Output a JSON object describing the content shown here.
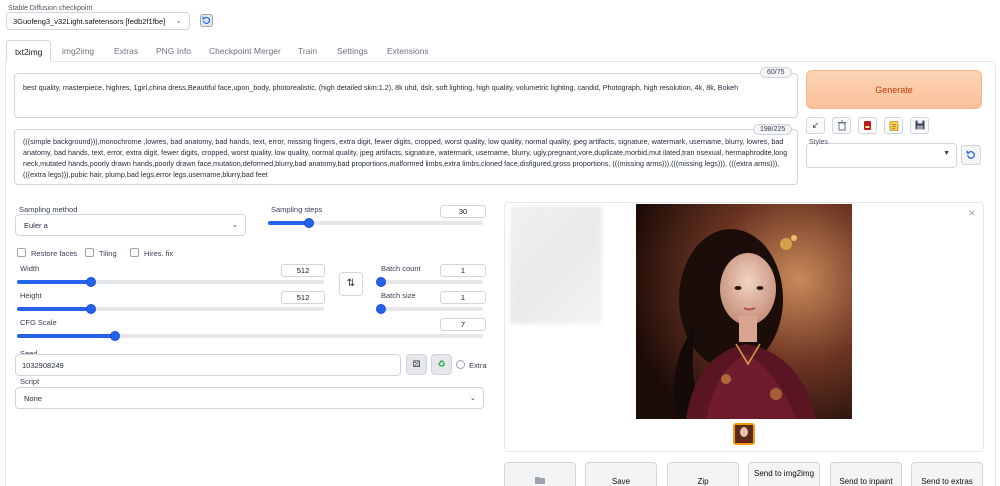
{
  "checkpoint": {
    "label": "Stable Diffusion checkpoint",
    "value": "3Guofeng3_v32Light.safetensors [fedb2f1fbe]"
  },
  "tabs": [
    "txt2img",
    "img2img",
    "Extras",
    "PNG Info",
    "Checkpoint Merger",
    "Train",
    "Settings",
    "Extensions"
  ],
  "prompt": {
    "text": "best quality, masterpiece, highres, 1girl,china dress,Beautiful face,upon_body, photorealistic, (high detailed skin:1.2), 8k uhd, dslr, soft lighting, high quality, volumetric lighting, candid, Photograph, high resolution, 4k, 8k, Bokeh",
    "counter": "60/75"
  },
  "negative_prompt": {
    "text": "(((simple background))),monochrome ,lowres, bad anatomy, bad hands, text, error, missing fingers, extra digit, fewer digits, cropped, worst quality, low quality, normal quality, jpeg artifacts, signature, watermark, username, blurry, lowres, bad anatomy, bad hands, text, error, extra digit, fewer digits, cropped, worst quality, low quality, normal quality, jpeg artifacts, signature, watermark, username, blurry, ugly,pregnant,vore,duplicate,morbid,mut ilated,tran nsexual, hermaphrodite,long neck,mutated hands,poorly drawn hands,poorly drawn face,mutation,deformed,blurry,bad anatomy,bad proportions,malformed limbs,extra limbs,cloned face,disfigured,gross proportions, (((missing arms))),(((missing legs))), (((extra arms))),(((extra legs))),pubic hair, plump,bad legs,error legs,username,blurry,bad feet",
    "counter": "198/225"
  },
  "generate_label": "Generate",
  "styles_label": "Styles",
  "sampling": {
    "method_label": "Sampling method",
    "method_value": "Euler a",
    "steps_label": "Sampling steps",
    "steps_value": "30",
    "steps_fraction": 0.19
  },
  "checkboxes": {
    "restore_faces": "Restore faces",
    "tiling": "Tiling",
    "hires_fix": "Hires. fix"
  },
  "width": {
    "label": "Width",
    "value": "512",
    "fraction": 0.24
  },
  "height": {
    "label": "Height",
    "value": "512",
    "fraction": 0.24
  },
  "batch_count": {
    "label": "Batch count",
    "value": "1",
    "fraction": 0
  },
  "batch_size": {
    "label": "Batch size",
    "value": "1",
    "fraction": 0
  },
  "cfg": {
    "label": "CFG Scale",
    "value": "7",
    "fraction": 0.21
  },
  "seed": {
    "label": "Seed",
    "value": "1032908249",
    "extra_label": "Extra"
  },
  "script": {
    "label": "Script",
    "value": "None"
  },
  "output_buttons": [
    "Save",
    "Zip",
    "Send to img2img",
    "Send to inpaint",
    "Send to extras"
  ],
  "colors": {
    "accent": "#2563eb",
    "generate_bg": "#fbbf99",
    "generate_text": "#c2410c"
  }
}
